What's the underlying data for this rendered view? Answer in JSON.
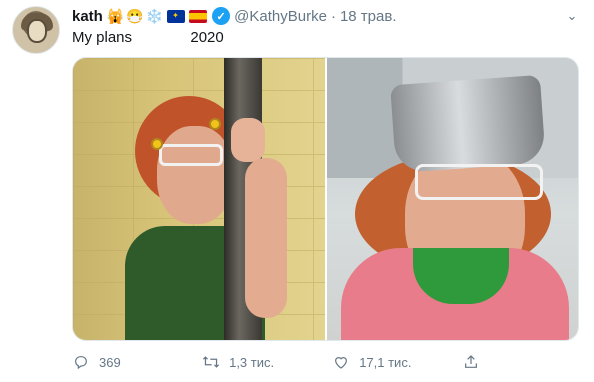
{
  "tweet": {
    "author_name": "kath",
    "author_emojis": [
      "🙀",
      "😷",
      "❄️"
    ],
    "flags": [
      "eu-flag",
      "spain-flag"
    ],
    "verified": true,
    "handle": "@KathyBurke",
    "separator": "·",
    "timestamp": "18 трав.",
    "text": "My plans              2020",
    "icons": {
      "more": "chevron-down-icon",
      "reply": "reply-icon",
      "retweet": "retweet-icon",
      "like": "heart-icon",
      "share": "share-icon"
    },
    "actions": {
      "reply_count": "369",
      "retweet_count": "1,3 тис.",
      "like_count": "17,1 тис."
    }
  },
  "colors": {
    "text": "#14171a",
    "muted": "#657786",
    "verified": "#1da1f2",
    "border": "#e1e8ed"
  }
}
